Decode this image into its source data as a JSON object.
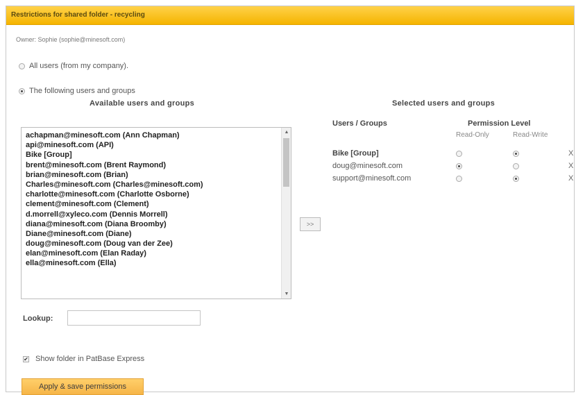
{
  "title": "Restrictions for shared folder - recycling",
  "owner": "Owner: Sophie (sophie@minesoft.com)",
  "options": {
    "all_users": "All users (from my company).",
    "following": "The following users and groups",
    "selected": "following"
  },
  "available": {
    "heading": "Available users and groups",
    "items": [
      "achapman@minesoft.com (Ann Chapman)",
      "api@minesoft.com (API)",
      "Bike [Group]",
      "brent@minesoft.com (Brent Raymond)",
      "brian@minesoft.com (Brian)",
      "Charles@minesoft.com (Charles@minesoft.com)",
      "charlotte@minesoft.com (Charlotte Osborne)",
      "clement@minesoft.com (Clement)",
      "d.morrell@xyleco.com (Dennis Morrell)",
      "diana@minesoft.com (Diana Broomby)",
      "Diane@minesoft.com (Diane)",
      "doug@minesoft.com (Doug van der Zee)",
      "elan@minesoft.com (Elan Raday)",
      "ella@minesoft.com (Ella)"
    ]
  },
  "move_button": ">>",
  "selected_panel": {
    "heading": "Selected users and groups",
    "col_users": "Users / Groups",
    "col_permission": "Permission Level",
    "read_only": "Read-Only",
    "read_write": "Read-Write",
    "remove_label": "X",
    "rows": [
      {
        "name": "Bike [Group]",
        "permission": "read-write"
      },
      {
        "name": "doug@minesoft.com",
        "permission": "read-only"
      },
      {
        "name": "support@minesoft.com",
        "permission": "read-write"
      }
    ]
  },
  "lookup": {
    "label": "Lookup:",
    "value": ""
  },
  "show_folder": {
    "label": "Show folder in PatBase Express",
    "checked": true
  },
  "apply_button": "Apply & save permissions"
}
